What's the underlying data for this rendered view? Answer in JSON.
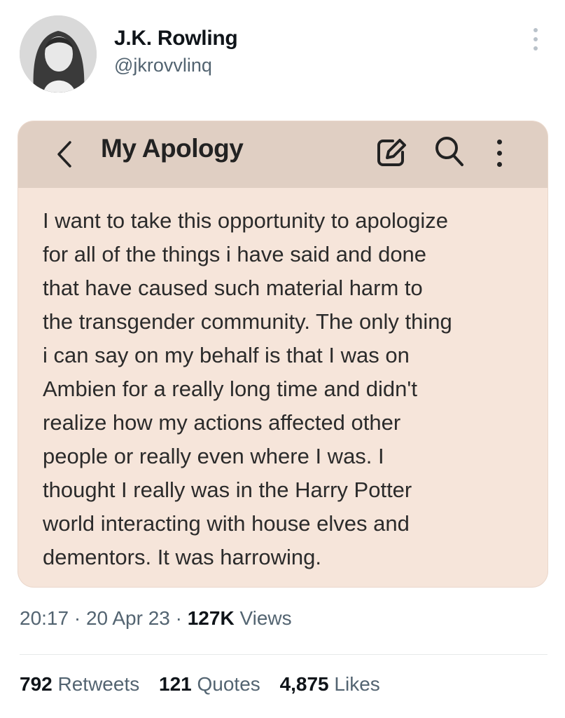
{
  "author": {
    "display_name": "J.K. Rowling",
    "handle": "@jkrovvlinq"
  },
  "note": {
    "title": "My Apology",
    "icons": [
      "back-icon",
      "edit-icon",
      "search-icon",
      "more-icon"
    ],
    "body_lines": [
      "I want to take this opportunity to apologize",
      "for all of the things i have said and done",
      "that have caused such material harm to",
      "the transgender community. The only thing",
      "i can say on my behalf is that I was on",
      "Ambien for a really long time and didn't",
      "realize how my actions affected other",
      "people or really even where I was. I",
      "thought I really was in the Harry Potter",
      "world interacting with house elves and",
      "dementors. It was harrowing."
    ],
    "bar_color": "#e0cfc3",
    "background_color": "#f6e5da"
  },
  "meta": {
    "time": "20:17",
    "date": "20 Apr 23",
    "views_count": "127K",
    "views_label": "Views",
    "separator": "·"
  },
  "stats": {
    "retweets_count": "792",
    "retweets_label": "Retweets",
    "quotes_count": "121",
    "quotes_label": "Quotes",
    "likes_count": "4,875",
    "likes_label": "Likes"
  }
}
